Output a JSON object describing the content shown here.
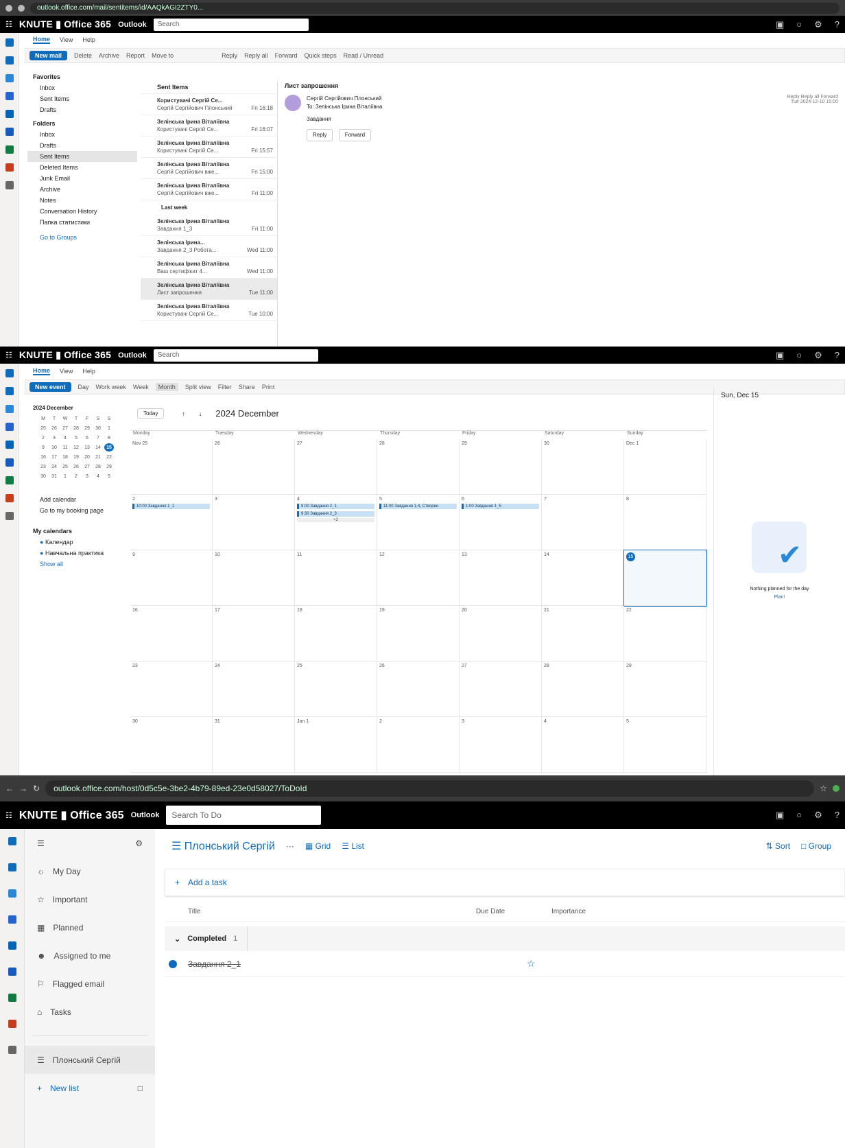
{
  "brand": "KNUTE",
  "suite_product": "Office 365",
  "app_name": "Outlook",
  "search_placeholder": "Search",
  "mail": {
    "address_bar": "outlook.office.com/mail/sentitems/id/AAQkAGI2ZTY0...",
    "tabs": [
      "Home",
      "View",
      "Help"
    ],
    "new_mail": "New mail",
    "ribbon": [
      "Delete",
      "Archive",
      "Report",
      "Move to",
      "Reply",
      "Reply all",
      "Forward",
      "Quick steps",
      "Read / Unread"
    ],
    "nav": {
      "favorites_header": "Favorites",
      "favorites": [
        "Inbox",
        "Sent Items",
        "Drafts"
      ],
      "folders_header": "Folders",
      "folders": [
        "Inbox",
        "Drafts",
        "Sent Items",
        "Deleted Items",
        "Junk Email",
        "Archive",
        "Notes",
        "Conversation History",
        "Папка статистики"
      ],
      "groups_link": "Go to Groups"
    },
    "list_header": "Sent Items",
    "last_week": "Last week",
    "messages": [
      {
        "from": "Користувачі Сергій Се...",
        "subject": "Сергій Сергійович Плонський",
        "time": "Fri 16:18"
      },
      {
        "from": "Зелінська Ірина Віталіївна",
        "subject": "Користувачі Сергій Се...",
        "time": "Fri 16:07"
      },
      {
        "from": "Зелінська Ірина Віталіївна",
        "subject": "Користувачі Сергій Се...",
        "time": "Fri 15:57"
      },
      {
        "from": "Зелінська Ірина Віталіївна",
        "subject": "Сергій Сергійович вже...",
        "time": "Fri 15:00"
      },
      {
        "from": "Зелінська Ірина Віталіївна",
        "subject": "Сергій Сергійович вже...",
        "time": "Fri 11:00"
      },
      {
        "from": "Зелінська Ірина Віталіївна",
        "subject": "Завдання 1_3",
        "time": "Fri 11:00"
      },
      {
        "from": "Зелінська Ірина...",
        "subject": "Завдання 2_3 Робота...",
        "time": "Wed 11:00"
      },
      {
        "from": "Зелінська Ірина Віталіївна",
        "subject": "Ваш сертифікат 4...",
        "time": "Wed 11:00"
      },
      {
        "from": "Зелінська Ірина Віталіївна",
        "subject": "Лист запрошення",
        "time": "Tue 11:00"
      },
      {
        "from": "Зелінська Ірина Віталіївна",
        "subject": "Користувачі Сергій Се...",
        "time": "Tue 10:00"
      }
    ],
    "reading": {
      "subject": "Лист запрошення",
      "sender": "Сергій Сергійович Плонський",
      "to": "To: Зелінська Ірина Віталіївна",
      "body": "Завдання",
      "reply": "Reply",
      "forward": "Forward",
      "actions": "Reply   Reply all   Forward",
      "date": "Tue 2024-12-10 10:00"
    }
  },
  "calendar": {
    "tabs": [
      "Home",
      "View",
      "Help"
    ],
    "new_event": "New event",
    "ribbon": [
      "Day",
      "Work week",
      "Week",
      "Month",
      "Split view",
      "Filter",
      "Share",
      "Print"
    ],
    "mini_title": "2024 December",
    "mini_days": [
      "M",
      "T",
      "W",
      "T",
      "F",
      "S",
      "S"
    ],
    "mini_weeks": [
      [
        "25",
        "26",
        "27",
        "28",
        "29",
        "30",
        "1"
      ],
      [
        "2",
        "3",
        "4",
        "5",
        "6",
        "7",
        "8"
      ],
      [
        "9",
        "10",
        "11",
        "12",
        "13",
        "14",
        "15"
      ],
      [
        "16",
        "17",
        "18",
        "19",
        "20",
        "21",
        "22"
      ],
      [
        "23",
        "24",
        "25",
        "26",
        "27",
        "28",
        "29"
      ],
      [
        "30",
        "31",
        "1",
        "2",
        "3",
        "4",
        "5"
      ]
    ],
    "add_calendar": "Add calendar",
    "booking": "Go to my booking page",
    "my_calendars": "My calendars",
    "calendars": [
      "Календар",
      "Навчальна практика"
    ],
    "show_all": "Show all",
    "today_btn": "Today",
    "month_title": "2024 December",
    "weekdays": [
      "Monday",
      "Tuesday",
      "Wednesday",
      "Thursday",
      "Friday",
      "Saturday",
      "Sunday"
    ],
    "weeks": [
      [
        "Nov 25",
        "26",
        "27",
        "28",
        "29",
        "30",
        "Dec 1"
      ],
      [
        "2",
        "3",
        "4",
        "5",
        "6",
        "7",
        "8"
      ],
      [
        "9",
        "10",
        "11",
        "12",
        "13",
        "14",
        "15"
      ],
      [
        "16",
        "17",
        "18",
        "19",
        "20",
        "21",
        "22"
      ],
      [
        "23",
        "24",
        "25",
        "26",
        "27",
        "28",
        "29"
      ],
      [
        "30",
        "31",
        "Jan 1",
        "2",
        "3",
        "4",
        "5"
      ]
    ],
    "events": {
      "mon2": "10:00 Завдання 1_1",
      "wed4a": "9:00 Завдання 2_1",
      "wed4b": "9:30 Завдання 2_3",
      "wed4more": "+2",
      "thu5": "11:00 Завдання 1-4, Створен",
      "fri6": "1:00 Завдання 1_5"
    },
    "side_date": "Sun, Dec 15",
    "nothing": "Nothing planned for the day",
    "plan": "Plan!"
  },
  "todo": {
    "address_bar": "outlook.office.com/host/0d5c5e-3be2-4b79-89ed-23e0d58027/ToDoId",
    "search_placeholder": "Search To Do",
    "nav": [
      "My Day",
      "Important",
      "Planned",
      "Assigned to me",
      "Flagged email",
      "Tasks"
    ],
    "list_name": "Плонський Сергій",
    "new_list": "New list",
    "grid": "Grid",
    "list": "List",
    "sort": "Sort",
    "group": "Group",
    "add_task": "Add a task",
    "col_title": "Title",
    "col_due": "Due Date",
    "col_importance": "Importance",
    "completed": "Completed",
    "completed_count": "1",
    "task": "Завдання 2_1"
  },
  "colors": {
    "accent": "#0f6cbd",
    "event": "#c7e0f4"
  }
}
